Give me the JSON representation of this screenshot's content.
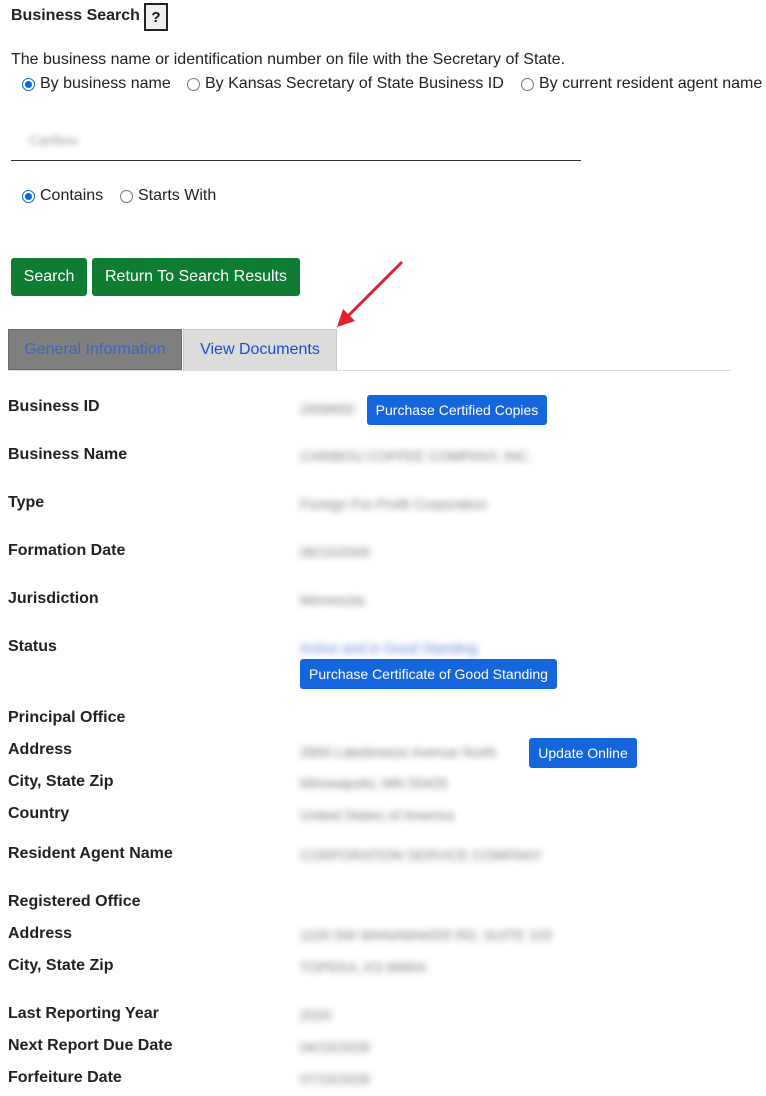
{
  "header": {
    "title": "Business Search",
    "help_label": "?"
  },
  "search": {
    "description": "The business name or identification number on file with the Secretary of State.",
    "search_by_options": [
      {
        "label": "By business name",
        "checked": true
      },
      {
        "label": "By Kansas Secretary of State Business ID",
        "checked": false
      },
      {
        "label": "By current resident agent name",
        "checked": false
      }
    ],
    "query_value": "Caribou",
    "match_options": [
      {
        "label": "Contains",
        "checked": true
      },
      {
        "label": "Starts With",
        "checked": false
      }
    ],
    "search_button": "Search",
    "return_button": "Return To Search Results"
  },
  "tabs": [
    {
      "label": "General Information",
      "active": true
    },
    {
      "label": "View Documents",
      "active": false
    }
  ],
  "details": {
    "business_id": {
      "label": "Business ID",
      "value": "2658650",
      "button": "Purchase Certified Copies"
    },
    "business_name": {
      "label": "Business Name",
      "value": "CARIBOU COFFEE COMPANY, INC."
    },
    "type": {
      "label": "Type",
      "value": "Foreign For-Profit Corporation"
    },
    "formation_date": {
      "label": "Formation Date",
      "value": "06/15/2000"
    },
    "jurisdiction": {
      "label": "Jurisdiction",
      "value": "Minnesota"
    },
    "status": {
      "label": "Status",
      "value": "Active and in Good Standing",
      "button": "Purchase Certificate of Good Standing"
    },
    "principal_office": {
      "heading": "Principal Office",
      "address_label": "Address",
      "address_value": "3900 Lakebreeze Avenue North",
      "address_button": "Update Online",
      "city_label": "City, State Zip",
      "city_value": "Minneapolis, MN 55429",
      "country_label": "Country",
      "country_value": "United States of America"
    },
    "resident_agent": {
      "label": "Resident Agent Name",
      "value": "CORPORATION SERVICE COMPANY"
    },
    "registered_office": {
      "heading": "Registered Office",
      "address_label": "Address",
      "address_value": "1100 SW WANAMAKER RD, SUITE 103",
      "city_label": "City, State Zip",
      "city_value": "TOPEKA, KS 66604"
    },
    "last_reporting_year": {
      "label": "Last Reporting Year",
      "value": "2020"
    },
    "next_report_due": {
      "label": "Next Report Due Date",
      "value": "04/15/2026"
    },
    "forfeiture_date": {
      "label": "Forfeiture Date",
      "value": "07/15/2026"
    }
  },
  "colors": {
    "green_button": "#0f7d31",
    "blue_button": "#1565dc",
    "annotation_arrow": "#e0202e"
  }
}
